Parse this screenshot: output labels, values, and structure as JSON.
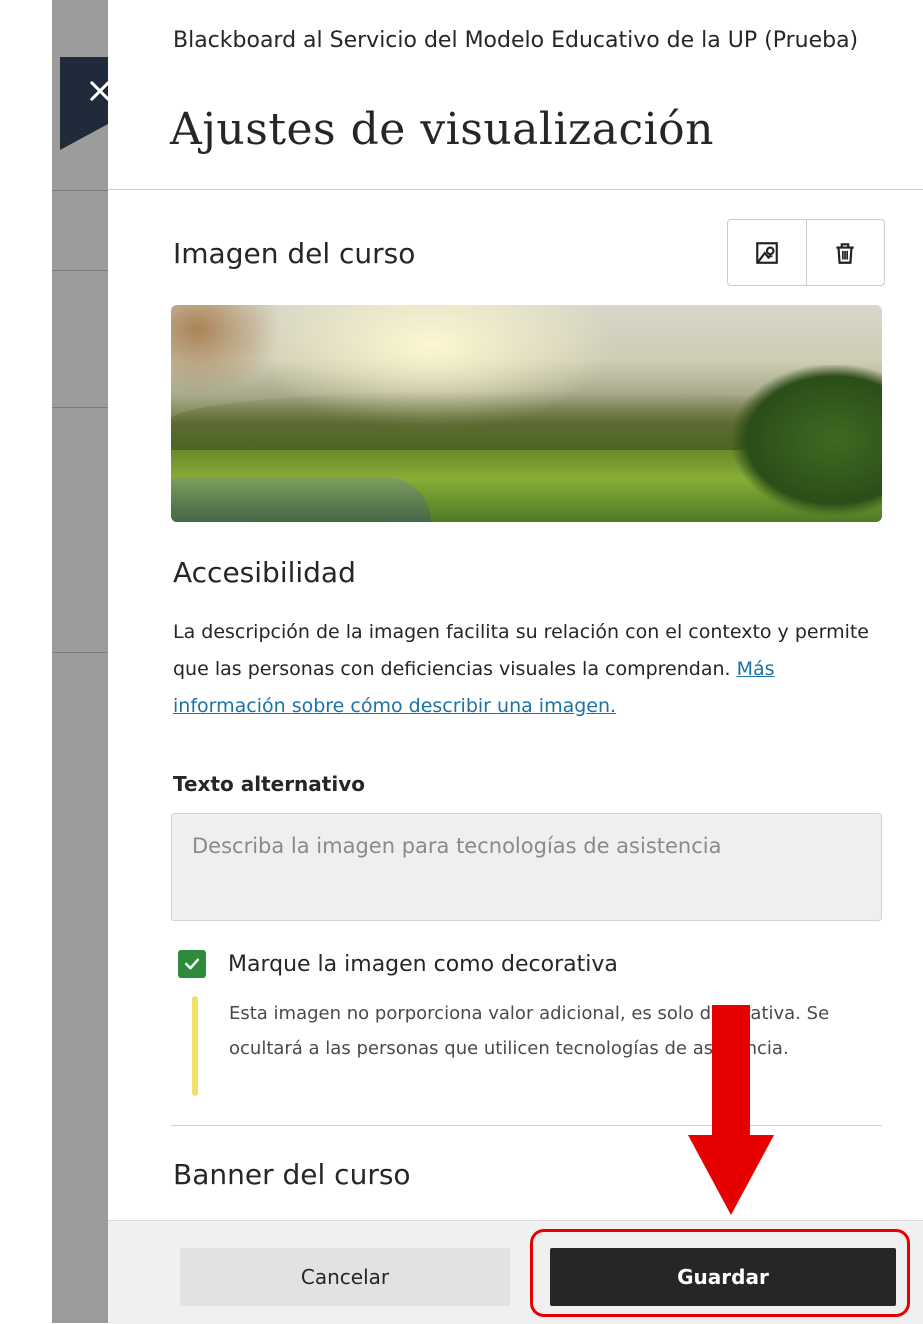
{
  "header": {
    "course_name": "Blackboard al Servicio del Modelo Educativo de la UP (Prueba)",
    "title": "Ajustes de visualización",
    "close_icon": "close-icon"
  },
  "course_image": {
    "heading": "Imagen del curso",
    "actions": [
      {
        "icon": "image-edit-icon"
      },
      {
        "icon": "trash-icon"
      }
    ]
  },
  "accessibility": {
    "heading": "Accesibilidad",
    "description": "La descripción de la imagen facilita su relación con el contexto y permite que las personas con deficiencias visuales la comprendan.",
    "link_text": "Más información sobre cómo describir una imagen.",
    "alt_label": "Texto alternativo",
    "alt_value": "",
    "alt_placeholder": "Describa la imagen para tecnologías de asistencia",
    "decorative_label": "Marque la imagen como decorativa",
    "decorative_checked": true,
    "decorative_note": "Esta imagen no porporciona valor adicional, es solo decorativa. Se ocultará a las personas que utilicen tecnologías de asistencia."
  },
  "banner": {
    "heading": "Banner del curso"
  },
  "footer": {
    "cancel_label": "Cancelar",
    "save_label": "Guardar"
  },
  "colors": {
    "header_dark": "#1f2a3a",
    "check_green": "#2e8b3a",
    "save_button": "#262626",
    "annotation_red": "#e60000",
    "note_bar": "#f3e06b",
    "link": "#1a73a8"
  }
}
